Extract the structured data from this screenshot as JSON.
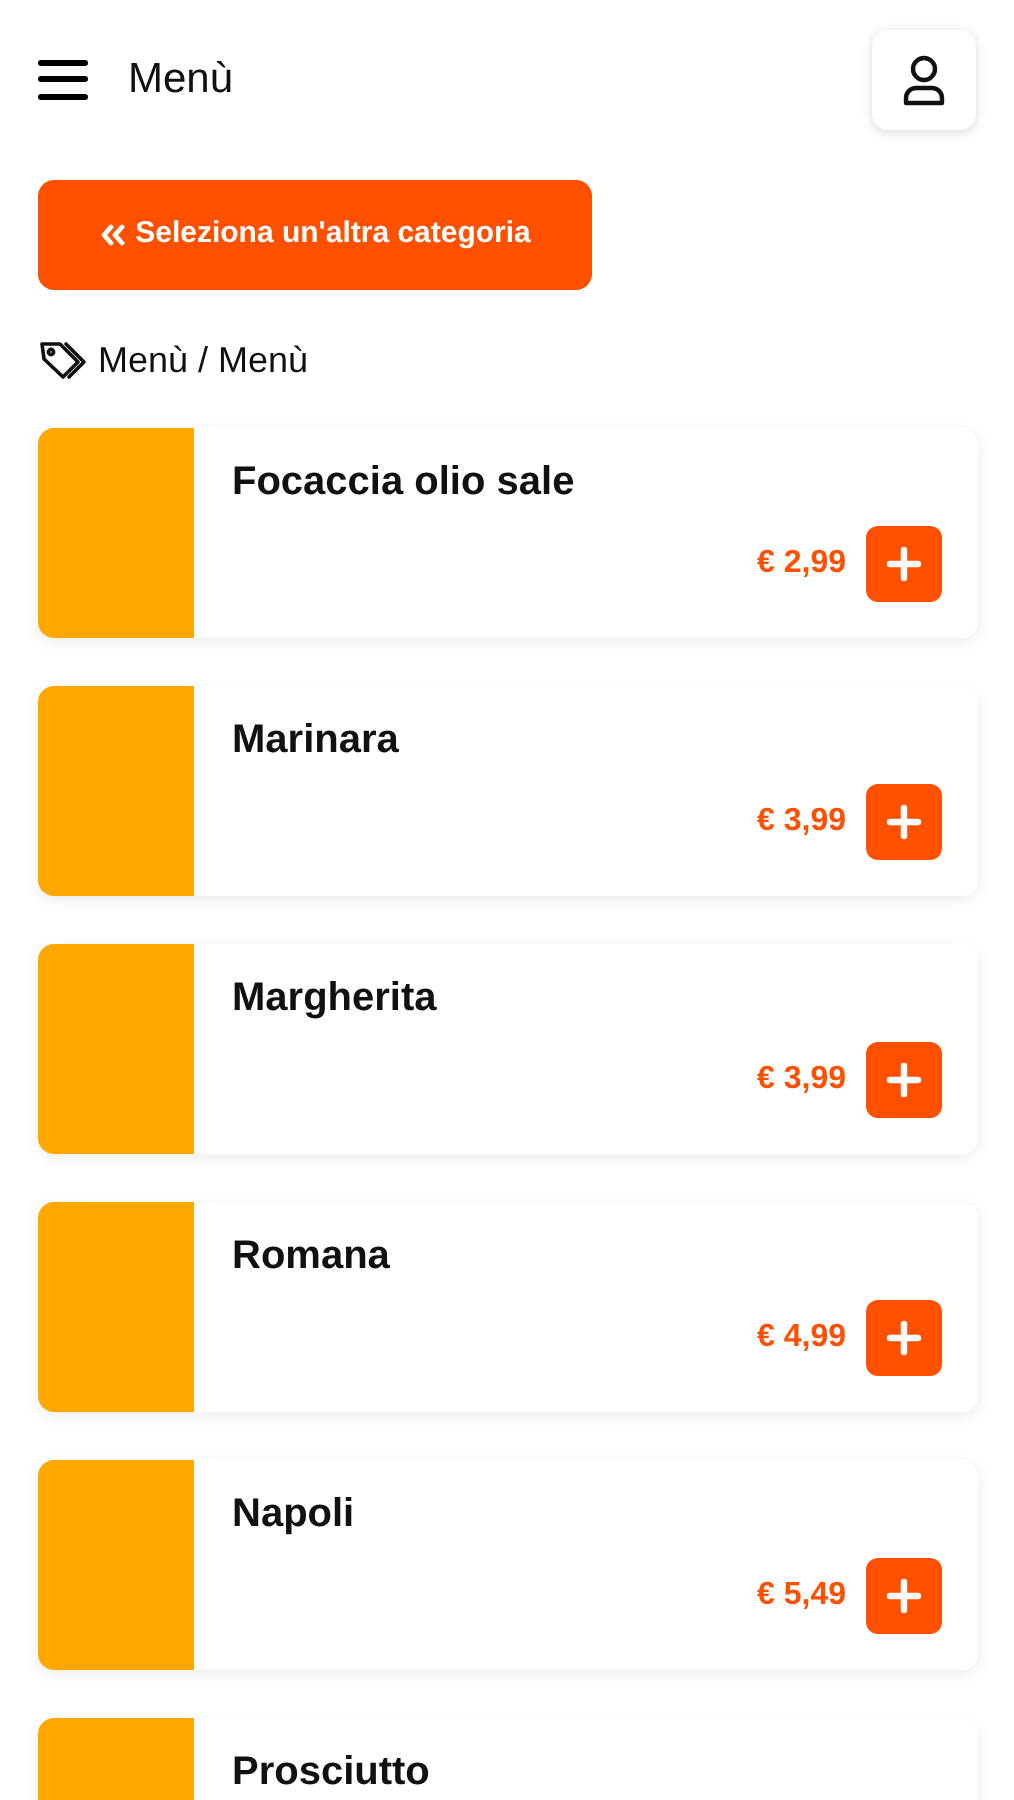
{
  "header": {
    "title": "Menù"
  },
  "back_button": {
    "label": "Seleziona un'altra categoria"
  },
  "breadcrumb": "Menù / Menù",
  "products": [
    {
      "name": "Focaccia olio sale",
      "price": "€ 2,99"
    },
    {
      "name": "Marinara",
      "price": "€ 3,99"
    },
    {
      "name": "Margherita",
      "price": "€ 3,99"
    },
    {
      "name": "Romana",
      "price": "€ 4,99"
    },
    {
      "name": "Napoli",
      "price": "€ 5,49"
    },
    {
      "name": "Prosciutto"
    }
  ]
}
